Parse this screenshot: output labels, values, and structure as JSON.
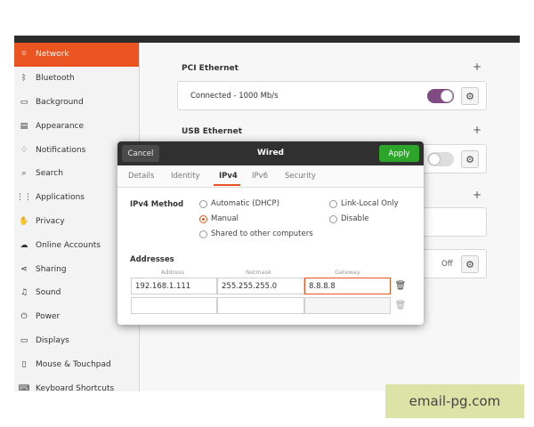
{
  "sidebar": {
    "items": [
      {
        "label": "Network",
        "icon": "network-icon",
        "glyph": "⌾"
      },
      {
        "label": "Bluetooth",
        "icon": "bluetooth-icon",
        "glyph": "ᛒ"
      },
      {
        "label": "Background",
        "icon": "monitor-icon",
        "glyph": "▭"
      },
      {
        "label": "Appearance",
        "icon": "appearance-icon",
        "glyph": "▤"
      },
      {
        "label": "Notifications",
        "icon": "bell-icon",
        "glyph": "♢"
      },
      {
        "label": "Search",
        "icon": "search-icon",
        "glyph": "⌕"
      },
      {
        "label": "Applications",
        "icon": "grid-icon",
        "glyph": "⋮⋮"
      },
      {
        "label": "Privacy",
        "icon": "hand-icon",
        "glyph": "✋"
      },
      {
        "label": "Online Accounts",
        "icon": "cloud-icon",
        "glyph": "☁"
      },
      {
        "label": "Sharing",
        "icon": "share-icon",
        "glyph": "⋖"
      },
      {
        "label": "Sound",
        "icon": "music-icon",
        "glyph": "♫"
      },
      {
        "label": "Power",
        "icon": "power-icon",
        "glyph": "⏻"
      },
      {
        "label": "Displays",
        "icon": "display-icon",
        "glyph": "▭"
      },
      {
        "label": "Mouse & Touchpad",
        "icon": "mouse-icon",
        "glyph": "▯"
      },
      {
        "label": "Keyboard Shortcuts",
        "icon": "keyboard-icon",
        "glyph": "⌨"
      }
    ]
  },
  "network": {
    "pci_title": "PCI Ethernet",
    "pci_status": "Connected - 1000 Mb/s",
    "usb_title": "USB Ethernet",
    "off_label": "Off",
    "plus": "+"
  },
  "dialog": {
    "cancel": "Cancel",
    "title": "Wired",
    "apply": "Apply",
    "tabs": [
      "Details",
      "Identity",
      "IPv4",
      "IPv6",
      "Security"
    ],
    "active_tab": "IPv4",
    "method_label": "IPv4 Method",
    "methods": {
      "automatic": "Automatic (DHCP)",
      "link_local": "Link-Local Only",
      "manual": "Manual",
      "disable": "Disable",
      "shared": "Shared to other computers"
    },
    "selected_method": "Manual",
    "addresses_label": "Addresses",
    "columns": [
      "Address",
      "Netmask",
      "Gateway"
    ],
    "rows": [
      {
        "address": "192.168.1.111",
        "netmask": "255.255.255.0",
        "gateway": "8.8.8.8"
      },
      {
        "address": "",
        "netmask": "",
        "gateway": ""
      }
    ]
  },
  "watermark": "email-pg.com",
  "colors": {
    "accent": "#e95420",
    "apply": "#2da52b",
    "toggle_on": "#7f4b82",
    "header": "#303030"
  }
}
